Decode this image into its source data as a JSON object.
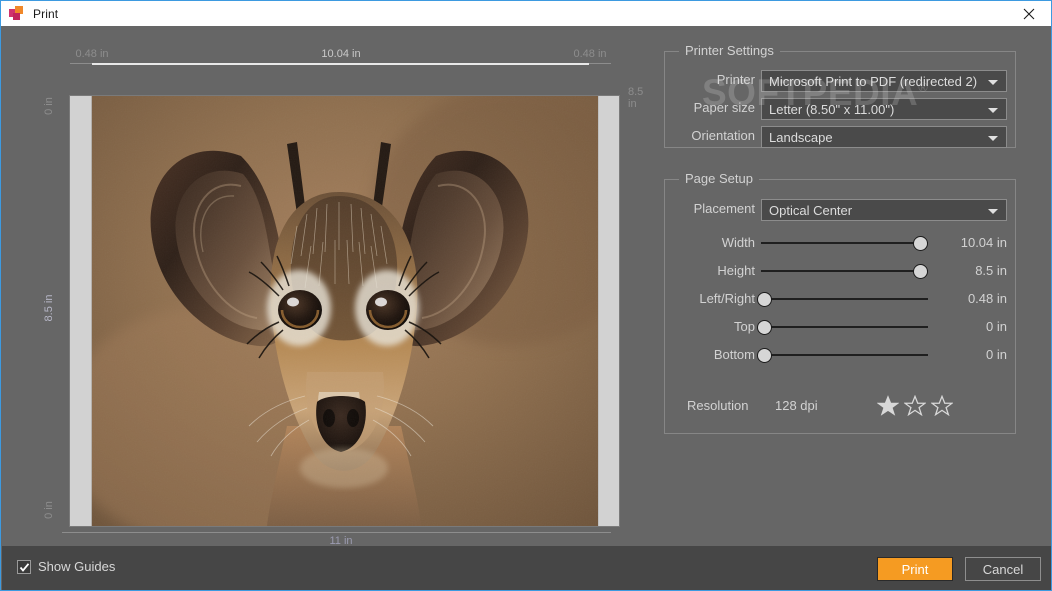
{
  "window": {
    "title": "Print",
    "app_icon": "app-tiles-icon",
    "close_icon": "close-icon"
  },
  "preview": {
    "ruler_top": {
      "left_margin": "0.48 in",
      "center": "10.04 in",
      "right_margin": "0.48 in"
    },
    "ruler_left": {
      "top": "0 in",
      "middle": "8.5 in",
      "bottom": "0 in"
    },
    "ruler_right": {
      "middle": "8.5 in"
    },
    "ruler_bottom": {
      "center": "11 in"
    },
    "image_alt": "dik-dik antelope close-up photograph"
  },
  "printer_settings": {
    "legend": "Printer Settings",
    "rows": [
      {
        "label": "Printer",
        "value": "Microsoft Print to PDF (redirected 2)"
      },
      {
        "label": "Paper size",
        "value": "Letter  (8.50\" x 11.00\")"
      },
      {
        "label": "Orientation",
        "value": "Landscape"
      }
    ]
  },
  "page_setup": {
    "legend": "Page Setup",
    "placement": {
      "label": "Placement",
      "value": "Optical Center"
    },
    "sliders": [
      {
        "label": "Width",
        "value": "10.04 in",
        "pos": 96
      },
      {
        "label": "Height",
        "value": "8.5 in",
        "pos": 96
      },
      {
        "label": "Left/Right",
        "value": "0.48 in",
        "pos": 1
      },
      {
        "label": "Top",
        "value": "0 in",
        "pos": 1
      },
      {
        "label": "Bottom",
        "value": "0 in",
        "pos": 1
      }
    ],
    "resolution": {
      "label": "Resolution",
      "value": "128 dpi",
      "stars_filled": 1,
      "stars_total": 3
    }
  },
  "watermark": {
    "text": "SOFTPEDIA",
    "mark": "®"
  },
  "footer": {
    "show_guides_label": "Show Guides",
    "show_guides_checked": true,
    "print_label": "Print",
    "cancel_label": "Cancel"
  },
  "colors": {
    "accent": "#f59b22",
    "window_border": "#3d9ae0",
    "panel_bg": "#666666",
    "footer_bg": "#464646"
  }
}
